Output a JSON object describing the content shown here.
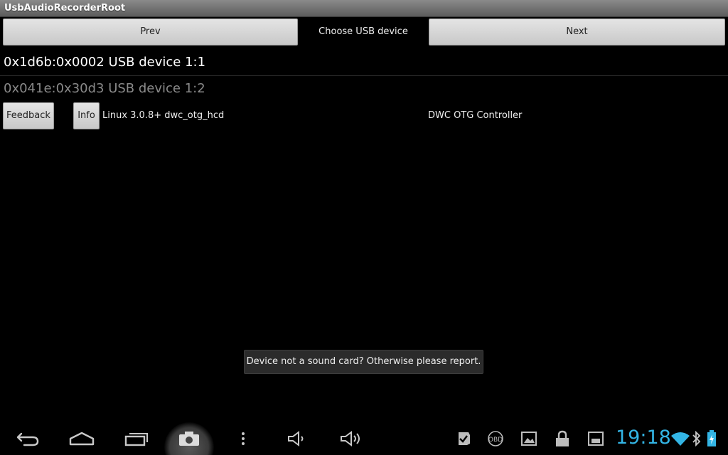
{
  "window": {
    "title": "UsbAudioRecorderRoot"
  },
  "nav": {
    "prev_label": "Prev",
    "title": "Choose USB device",
    "next_label": "Next"
  },
  "devices": [
    {
      "label": "0x1d6b:0x0002 USB device 1:1",
      "state": "selected"
    },
    {
      "label": "0x041e:0x30d3 USB device 1:2",
      "state": "dimmed"
    }
  ],
  "actions": {
    "feedback_label": "Feedback",
    "info_label": "Info"
  },
  "device_info": {
    "driver": "Linux 3.0.8+ dwc_otg_hcd",
    "controller": "DWC OTG Controller"
  },
  "toast": {
    "message": "Device not a sound card? Otherwise please report."
  },
  "system_bar": {
    "clock": "19:18",
    "accent": "#33b5e5",
    "icons": [
      "back-icon",
      "home-icon",
      "recent-apps-icon",
      "camera-icon",
      "menu-icon",
      "volume-down-icon",
      "volume-up-icon",
      "check-notification-icon",
      "obd-icon",
      "gallery-icon",
      "lock-notification-icon",
      "screenshot-icon",
      "wifi-icon",
      "bluetooth-icon",
      "battery-icon"
    ]
  }
}
